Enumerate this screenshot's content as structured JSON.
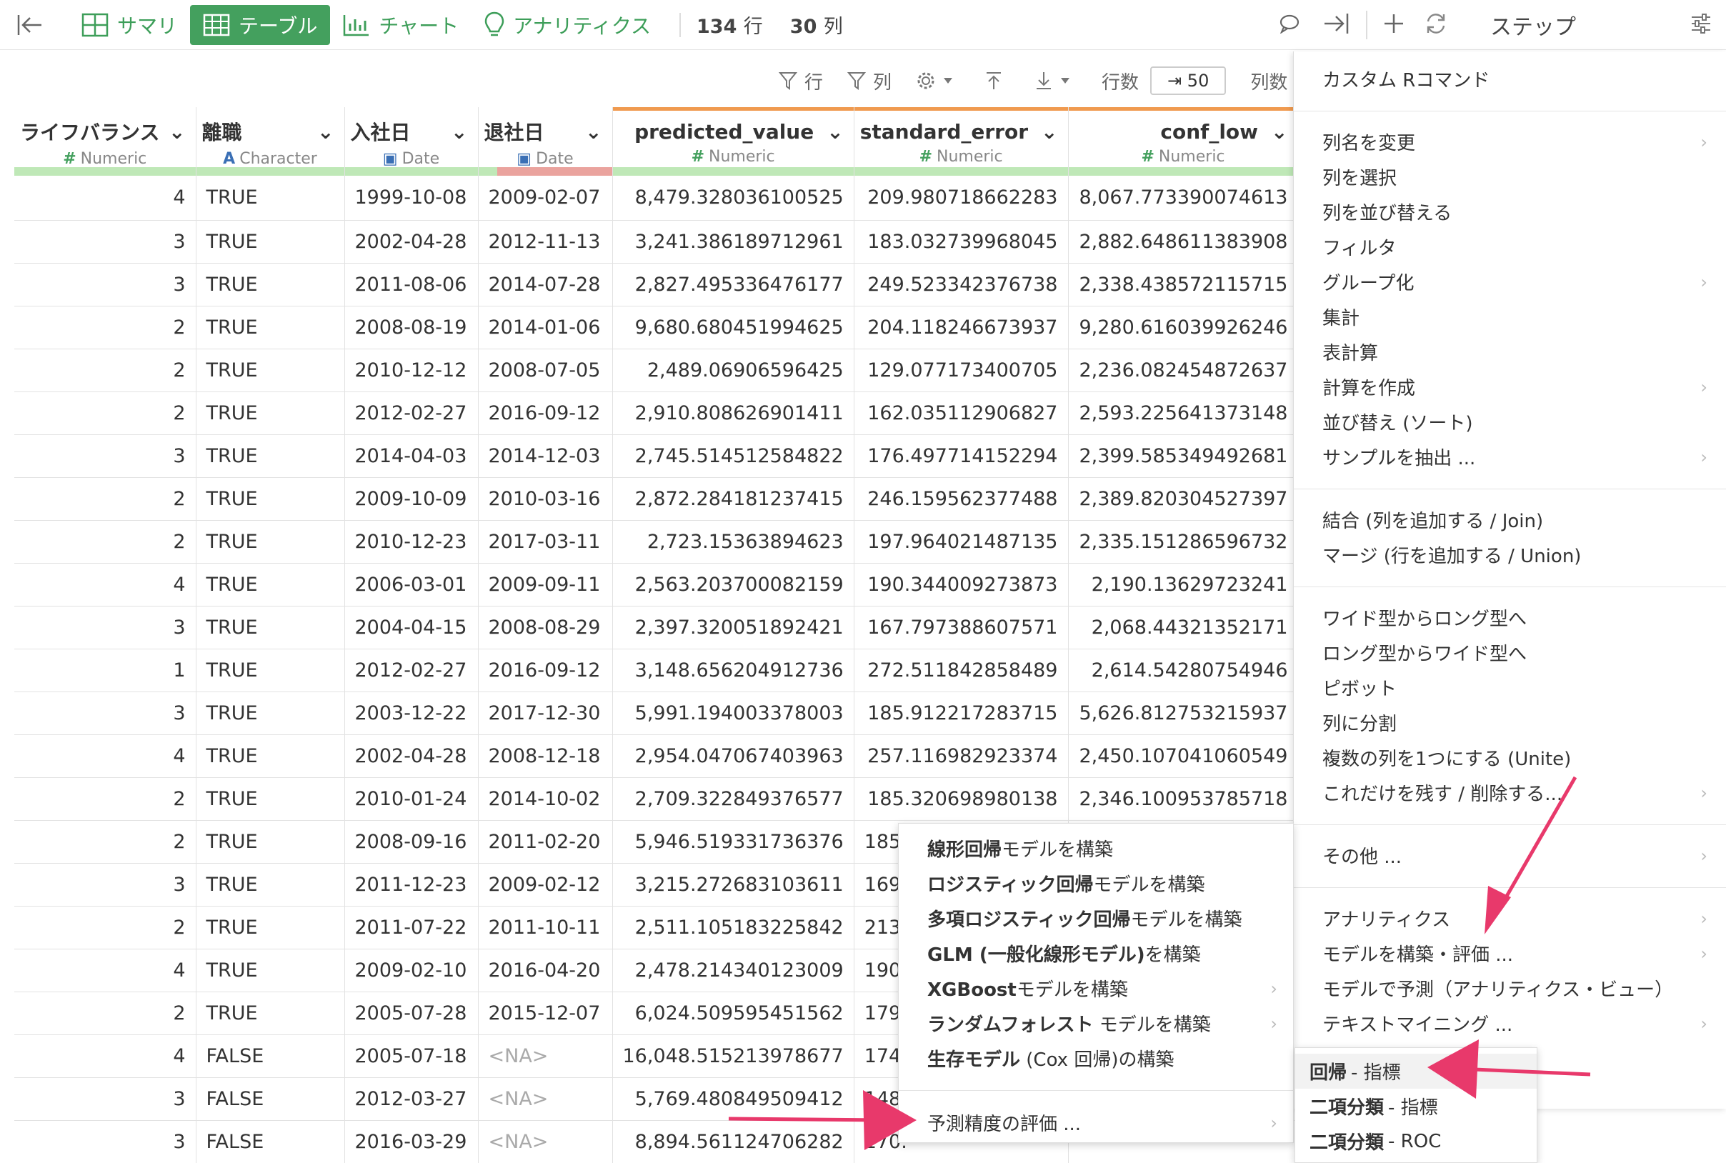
{
  "toolbar": {
    "views": [
      {
        "label": "サマリ",
        "active": false
      },
      {
        "label": "テーブル",
        "active": true
      },
      {
        "label": "チャート",
        "active": false
      },
      {
        "label": "アナリティクス",
        "active": false
      }
    ],
    "rows_count": "134",
    "rows_unit": "行",
    "cols_count": "30",
    "cols_unit": "列",
    "step_title": "ステップ"
  },
  "subbar": {
    "row_filter": "行",
    "col_filter": "列",
    "rows_label": "行数",
    "rows_value": "50",
    "cols_label": "列数"
  },
  "columns": [
    {
      "name": "ライフバランス",
      "type": "Numeric",
      "symbol": "#"
    },
    {
      "name": "離職",
      "type": "Character",
      "symbol": "A"
    },
    {
      "name": "入社日",
      "type": "Date",
      "symbol": "date"
    },
    {
      "name": "退社日",
      "type": "Date",
      "symbol": "date"
    },
    {
      "name": "predicted_value",
      "type": "Numeric",
      "symbol": "#"
    },
    {
      "name": "standard_error",
      "type": "Numeric",
      "symbol": "#"
    },
    {
      "name": "conf_low",
      "type": "Numeric",
      "symbol": "#"
    }
  ],
  "rows": [
    [
      "4",
      "TRUE",
      "1999-10-08",
      "2009-02-07",
      "8,479.328036100525",
      "209.980718662283",
      "8,067.773390074613"
    ],
    [
      "3",
      "TRUE",
      "2002-04-28",
      "2012-11-13",
      "3,241.386189712961",
      "183.032739968045",
      "2,882.648611383908"
    ],
    [
      "3",
      "TRUE",
      "2011-08-06",
      "2014-07-28",
      "2,827.495336476177",
      "249.523342376738",
      "2,338.438572115715"
    ],
    [
      "2",
      "TRUE",
      "2008-08-19",
      "2014-01-06",
      "9,680.680451994625",
      "204.118246673937",
      "9,280.616039926246"
    ],
    [
      "2",
      "TRUE",
      "2010-12-12",
      "2008-07-05",
      "2,489.06906596425",
      "129.077173400705",
      "2,236.082454872637"
    ],
    [
      "2",
      "TRUE",
      "2012-02-27",
      "2016-09-12",
      "2,910.808626901411",
      "162.035112906827",
      "2,593.225641373148"
    ],
    [
      "3",
      "TRUE",
      "2014-04-03",
      "2014-12-03",
      "2,745.514512584822",
      "176.497714152294",
      "2,399.585349492681"
    ],
    [
      "2",
      "TRUE",
      "2009-10-09",
      "2010-03-16",
      "2,872.284181237415",
      "246.159562377488",
      "2,389.820304527397"
    ],
    [
      "2",
      "TRUE",
      "2010-12-23",
      "2017-03-11",
      "2,723.15363894623",
      "197.964021487135",
      "2,335.151286596732"
    ],
    [
      "4",
      "TRUE",
      "2006-03-01",
      "2009-09-11",
      "2,563.203700082159",
      "190.344009273873",
      "2,190.13629723241"
    ],
    [
      "3",
      "TRUE",
      "2004-04-15",
      "2008-08-29",
      "2,397.320051892421",
      "167.797388607571",
      "2,068.44321352171"
    ],
    [
      "1",
      "TRUE",
      "2012-02-27",
      "2016-09-12",
      "3,148.656204912736",
      "272.511842858489",
      "2,614.54280754946"
    ],
    [
      "3",
      "TRUE",
      "2003-12-22",
      "2017-12-30",
      "5,991.194003378003",
      "185.912217283715",
      "5,626.812753215937"
    ],
    [
      "4",
      "TRUE",
      "2002-04-28",
      "2008-12-18",
      "2,954.047067403963",
      "257.116982923374",
      "2,450.107041060549"
    ],
    [
      "2",
      "TRUE",
      "2010-01-24",
      "2014-10-02",
      "2,709.322849376577",
      "185.320698980138",
      "2,346.100953785718"
    ],
    [
      "2",
      "TRUE",
      "2008-09-16",
      "2011-02-20",
      "5,946.519331736376",
      "185.",
      ""
    ],
    [
      "3",
      "TRUE",
      "2011-12-23",
      "2009-02-12",
      "3,215.272683103611",
      "169.",
      ""
    ],
    [
      "2",
      "TRUE",
      "2011-07-22",
      "2011-10-11",
      "2,511.105183225842",
      "213.",
      ""
    ],
    [
      "4",
      "TRUE",
      "2009-02-10",
      "2016-04-20",
      "2,478.214340123009",
      "190.",
      ""
    ],
    [
      "2",
      "TRUE",
      "2005-07-28",
      "2015-12-07",
      "6,024.509595451562",
      "179",
      ""
    ],
    [
      "4",
      "FALSE",
      "2005-07-18",
      "<NA>",
      "16,048.515213978677",
      "174.",
      ""
    ],
    [
      "3",
      "FALSE",
      "2012-03-27",
      "<NA>",
      "5,769.480849509412",
      "148.",
      ""
    ],
    [
      "3",
      "FALSE",
      "2016-03-29",
      "<NA>",
      "8,894.561124706282",
      "170.",
      ""
    ]
  ],
  "step_menu": {
    "groups": [
      [
        {
          "label": "カスタム Rコマンド",
          "arrow": false
        }
      ],
      [
        {
          "label": "列名を変更",
          "arrow": true
        },
        {
          "label": "列を選択",
          "arrow": false
        },
        {
          "label": "列を並び替える",
          "arrow": false
        },
        {
          "label": "フィルタ",
          "arrow": false
        },
        {
          "label": "グループ化",
          "arrow": true
        },
        {
          "label": "集計",
          "arrow": false
        },
        {
          "label": "表計算",
          "arrow": false
        },
        {
          "label": "計算を作成",
          "arrow": true
        },
        {
          "label": "並び替え (ソート)",
          "arrow": false
        },
        {
          "label": "サンプルを抽出 ...",
          "arrow": true
        }
      ],
      [
        {
          "label": "結合 (列を追加する / Join)",
          "arrow": false
        },
        {
          "label": "マージ (行を追加する / Union)",
          "arrow": false
        }
      ],
      [
        {
          "label": "ワイド型からロング型へ",
          "arrow": false
        },
        {
          "label": "ロング型からワイド型へ",
          "arrow": false
        },
        {
          "label": "ピボット",
          "arrow": false
        },
        {
          "label": "列に分割",
          "arrow": false
        },
        {
          "label": "複数の列を1つにする (Unite)",
          "arrow": false
        },
        {
          "label": "これだけを残す / 削除する...",
          "arrow": true
        }
      ],
      [
        {
          "label": "その他 ...",
          "arrow": true
        }
      ],
      [
        {
          "label": "アナリティクス",
          "arrow": true
        },
        {
          "label": "モデルを構築・評価 ...",
          "arrow": true
        },
        {
          "label": "モデルで予測（アナリティクス・ビュー）",
          "arrow": false
        },
        {
          "label": "テキストマイニング ...",
          "arrow": true
        }
      ]
    ]
  },
  "model_menu": {
    "items": [
      {
        "bold": "線形回帰",
        "rest": "モデルを構築",
        "arrow": false
      },
      {
        "bold": "ロジスティック回帰",
        "rest": "モデルを構築",
        "arrow": false
      },
      {
        "bold": "多項ロジスティック回帰",
        "rest": "モデルを構築",
        "arrow": false
      },
      {
        "bold": "GLM (一般化線形モデル)",
        "rest": "を構築",
        "arrow": false
      },
      {
        "bold": "XGBoost",
        "rest": "モデルを構築",
        "arrow": true
      },
      {
        "bold": "ランダムフォレスト",
        "rest": " モデルを構築",
        "arrow": true
      },
      {
        "bold": "生存モデル",
        "rest": " (Cox 回帰)の構築",
        "arrow": false
      }
    ],
    "eval_item": "予測精度の評価 ..."
  },
  "eval_menu": {
    "items": [
      {
        "bold": "回帰",
        "rest": "- 指標",
        "highlight": true
      },
      {
        "bold": "二項分類",
        "rest": "- 指標",
        "highlight": false
      },
      {
        "bold": "二項分類",
        "rest": "- ROC",
        "highlight": false
      }
    ]
  },
  "colors": {
    "accent_green": "#44a05e",
    "annotation_pink": "#e8396b",
    "numeric_bar": "#bfe8b7",
    "missing_bar": "#eaa39e",
    "model_stripe": "#f09a4f"
  }
}
